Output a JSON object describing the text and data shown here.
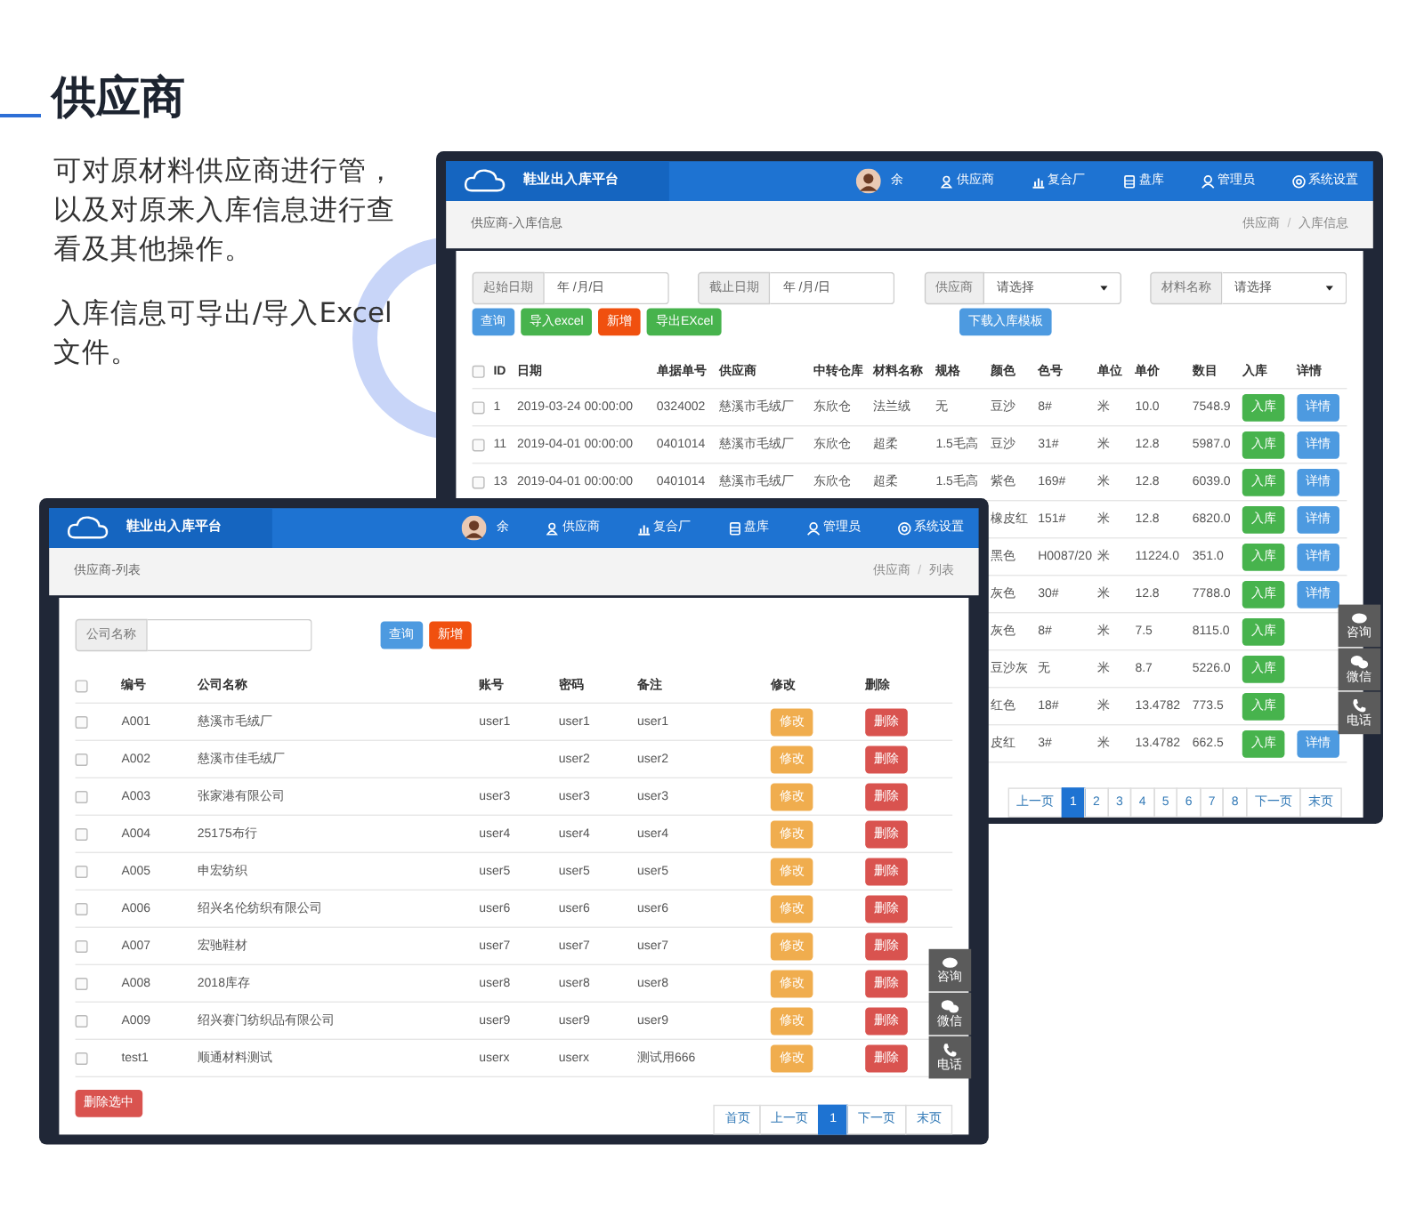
{
  "intro": {
    "title": "供应商",
    "paragraphs": [
      "可对原材料供应商进行管，以及对原来入库信息进行查看及其他操作。",
      "入库信息可导出/导入Excel文件。"
    ]
  },
  "inbound_window": {
    "app_title": "鞋业出入库平台",
    "user": "余",
    "nav": [
      "供应商",
      "复合厂",
      "盘库",
      "管理员",
      "系统设置"
    ],
    "page_title": "供应商-入库信息",
    "breadcrumb": [
      "供应商",
      "入库信息"
    ],
    "breadcrumb_separator": "/",
    "filters": [
      {
        "kind": "date",
        "label": "起始日期",
        "placeholder": "年 /月/日"
      },
      {
        "kind": "date",
        "label": "截止日期",
        "placeholder": "年 /月/日"
      },
      {
        "kind": "select",
        "label": "供应商",
        "value": "请选择"
      },
      {
        "kind": "select",
        "label": "材料名称",
        "value": "请选择"
      }
    ],
    "buttons": [
      {
        "kind": "info",
        "label": "查询"
      },
      {
        "kind": "success",
        "label": "导入excel"
      },
      {
        "kind": "danger",
        "label": "新增"
      },
      {
        "kind": "success",
        "label": "导出EXcel"
      }
    ],
    "template_button": "下载入库模板",
    "columns": [
      "ID",
      "日期",
      "单据单号",
      "供应商",
      "中转仓库",
      "材料名称",
      "规格",
      "颜色",
      "色号",
      "单位",
      "单价",
      "数目",
      "入库",
      "详情"
    ],
    "header_checked": false,
    "rows": [
      {
        "checked": false,
        "cells": [
          "1",
          "2019-03-24 00:00:00",
          "0324002",
          "慈溪市毛绒厂",
          "东欣仓",
          "法兰绒",
          "无",
          "豆沙",
          "8#",
          "米",
          "10.0",
          "7548.9"
        ],
        "actions": [
          "入库",
          "详情"
        ]
      },
      {
        "checked": false,
        "cells": [
          "11",
          "2019-04-01 00:00:00",
          "0401014",
          "慈溪市毛绒厂",
          "东欣仓",
          "超柔",
          "1.5毛高",
          "豆沙",
          "31#",
          "米",
          "12.8",
          "5987.0"
        ],
        "actions": [
          "入库",
          "详情"
        ]
      },
      {
        "checked": false,
        "cells": [
          "13",
          "2019-04-01 00:00:00",
          "0401014",
          "慈溪市毛绒厂",
          "东欣仓",
          "超柔",
          "1.5毛高",
          "紫色",
          "169#",
          "米",
          "12.8",
          "6039.0"
        ],
        "actions": [
          "入库",
          "详情"
        ]
      },
      {
        "cells": [
          "橡皮红",
          "151#",
          "米",
          "12.8",
          "6820.0"
        ],
        "actions": [
          "入库",
          "详情"
        ]
      },
      {
        "cells": [
          "黑色",
          "H0087/20",
          "米",
          "11224.0",
          "351.0"
        ],
        "actions": [
          "入库",
          "详情"
        ]
      },
      {
        "cells": [
          "灰色",
          "30#",
          "米",
          "12.8",
          "7788.0"
        ],
        "actions": [
          "入库",
          "详情"
        ]
      },
      {
        "cells": [
          "灰色",
          "8#",
          "米",
          "7.5",
          "8115.0"
        ],
        "actions": [
          "入库"
        ]
      },
      {
        "cells": [
          "豆沙灰",
          "无",
          "米",
          "8.7",
          "5226.0"
        ],
        "actions": [
          "入库"
        ]
      },
      {
        "cells": [
          "红色",
          "18#",
          "米",
          "13.4782",
          "773.5"
        ],
        "actions": [
          "入库"
        ]
      },
      {
        "cells": [
          "皮红",
          "3#",
          "米",
          "13.4782",
          "662.5"
        ],
        "actions": [
          "入库",
          "详情"
        ]
      }
    ],
    "pagination": [
      {
        "label": "上一页",
        "selected": false
      },
      {
        "label": "1",
        "selected": true
      },
      {
        "label": "2",
        "selected": false
      },
      {
        "label": "3",
        "selected": false
      },
      {
        "label": "4",
        "selected": false
      },
      {
        "label": "5",
        "selected": false
      },
      {
        "label": "6",
        "selected": false
      },
      {
        "label": "7",
        "selected": false
      },
      {
        "label": "8",
        "selected": false
      },
      {
        "label": "下一页",
        "selected": false
      },
      {
        "label": "末页",
        "selected": false
      }
    ],
    "side_widget": [
      "咨询",
      "微信",
      "电话"
    ]
  },
  "supplier_window": {
    "app_title": "鞋业出入库平台",
    "user": "余",
    "nav": [
      "供应商",
      "复合厂",
      "盘库",
      "管理员",
      "系统设置"
    ],
    "page_title": "供应商-列表",
    "breadcrumb": [
      "供应商",
      "列表"
    ],
    "breadcrumb_separator": "/",
    "search_label": "公司名称",
    "buttons": [
      {
        "kind": "info",
        "label": "查询"
      },
      {
        "kind": "danger",
        "label": "新增"
      }
    ],
    "columns": [
      "编号",
      "公司名称",
      "账号",
      "密码",
      "备注",
      "修改",
      "删除"
    ],
    "header_checked": false,
    "rows": [
      {
        "checked": false,
        "cells": [
          "A001",
          "慈溪市毛绒厂",
          "user1",
          "user1",
          "user1"
        ],
        "actions": [
          "修改",
          "删除"
        ]
      },
      {
        "checked": false,
        "cells": [
          "A002",
          "慈溪市佳毛绒厂",
          "",
          "user2",
          "user2"
        ],
        "actions": [
          "修改",
          "删除"
        ]
      },
      {
        "checked": false,
        "cells": [
          "A003",
          "张家港有限公司",
          "user3",
          "user3",
          "user3"
        ],
        "actions": [
          "修改",
          "删除"
        ]
      },
      {
        "checked": false,
        "cells": [
          "A004",
          "25175布行",
          "user4",
          "user4",
          "user4"
        ],
        "actions": [
          "修改",
          "删除"
        ]
      },
      {
        "checked": false,
        "cells": [
          "A005",
          "申宏纺织",
          "user5",
          "user5",
          "user5"
        ],
        "actions": [
          "修改",
          "删除"
        ]
      },
      {
        "checked": false,
        "cells": [
          "A006",
          "绍兴名伦纺织有限公司",
          "user6",
          "user6",
          "user6"
        ],
        "actions": [
          "修改",
          "删除"
        ]
      },
      {
        "checked": false,
        "cells": [
          "A007",
          "宏驰鞋材",
          "user7",
          "user7",
          "user7"
        ],
        "actions": [
          "修改",
          "删除"
        ]
      },
      {
        "checked": false,
        "cells": [
          "A008",
          "2018库存",
          "user8",
          "user8",
          "user8"
        ],
        "actions": [
          "修改",
          "删除"
        ]
      },
      {
        "checked": false,
        "cells": [
          "A009",
          "绍兴赛门纺织品有限公司",
          "user9",
          "user9",
          "user9"
        ],
        "actions": [
          "修改",
          "删除"
        ]
      },
      {
        "checked": false,
        "cells": [
          "test1",
          "顺通材料测试",
          "userx",
          "userx",
          "测试用666"
        ],
        "actions": [
          "修改",
          "删除"
        ]
      }
    ],
    "delete_selected": "删除选中",
    "pagination": [
      {
        "label": "首页",
        "selected": false
      },
      {
        "label": "上一页",
        "selected": false
      },
      {
        "label": "1",
        "selected": true
      },
      {
        "label": "下一页",
        "selected": false
      },
      {
        "label": "末页",
        "selected": false
      }
    ],
    "side_widget": [
      "咨询",
      "微信",
      "电话"
    ]
  }
}
